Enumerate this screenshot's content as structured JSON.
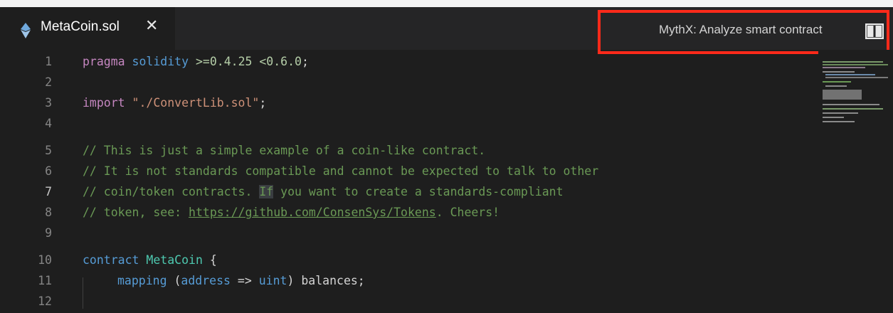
{
  "tab": {
    "file_name": "MetaCoin.sol",
    "close_glyph": "✕"
  },
  "toolbar": {
    "action_label": "MythX: Analyze smart contract",
    "split_icon": "split-editor-icon"
  },
  "editor": {
    "line_numbers": [
      "1",
      "2",
      "3",
      "4",
      "5",
      "6",
      "7",
      "8",
      "9",
      "10",
      "11",
      "12"
    ],
    "active_line": "7",
    "lines": {
      "l1": {
        "kw": "pragma",
        "name": "solidity",
        "ver": ">=0.4.25 <0.6.0",
        "semi": ";"
      },
      "l3": {
        "kw": "import",
        "str": "\"./ConvertLib.sol\"",
        "semi": ";"
      },
      "l5": "// This is just a simple example of a coin-like contract.",
      "l6": "// It is not standards compatible and cannot be expected to talk to other",
      "l7": {
        "pre": "// coin/token contracts. ",
        "hl": "If",
        "post": " you want to create a standards-compliant"
      },
      "l8": {
        "pre": "// token, see: ",
        "url": "https://github.com/ConsenSys/Tokens",
        "post": ". Cheers!"
      },
      "l10": {
        "kw": "contract",
        "name": "MetaCoin",
        "brace": " {"
      },
      "l11": {
        "kw": "mapping",
        "p1": " (",
        "t1": "address",
        "arrow": " => ",
        "t2": "uint",
        "p2": ") balances;"
      }
    }
  },
  "colors": {
    "highlight_box": "#ff2a1a",
    "editor_bg": "#1e1e1e",
    "comment": "#6a9955",
    "keyword": "#c586c0"
  }
}
